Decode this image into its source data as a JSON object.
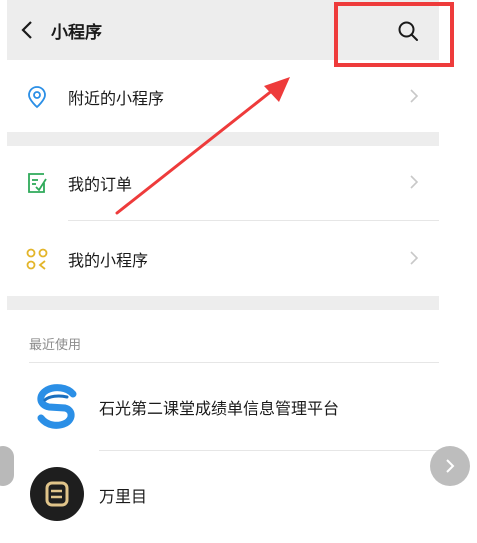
{
  "navbar": {
    "title": "小程序",
    "back_icon": "chevron-left-icon",
    "search_icon": "search-icon"
  },
  "menu": {
    "nearby": {
      "label": "附近的小程序",
      "icon": "location-pin-icon"
    },
    "orders": {
      "label": "我的订单",
      "icon": "checklist-icon"
    },
    "my_mini_programs": {
      "label": "我的小程序",
      "icon": "apps-grid-icon"
    }
  },
  "recent": {
    "section_label": "最近使用",
    "apps": [
      {
        "name": "石光第二课堂成绩单信息管理平台",
        "icon": "blue-s-logo-icon"
      },
      {
        "name": "万里目",
        "icon": "black-circle-logo-icon"
      }
    ]
  },
  "colors": {
    "accent_blue": "#2b8fe6",
    "green_icon": "#2faa5a",
    "yellow_icon": "#e3b52a",
    "annotation_red": "#ee3b3b",
    "background": "#ededed"
  }
}
